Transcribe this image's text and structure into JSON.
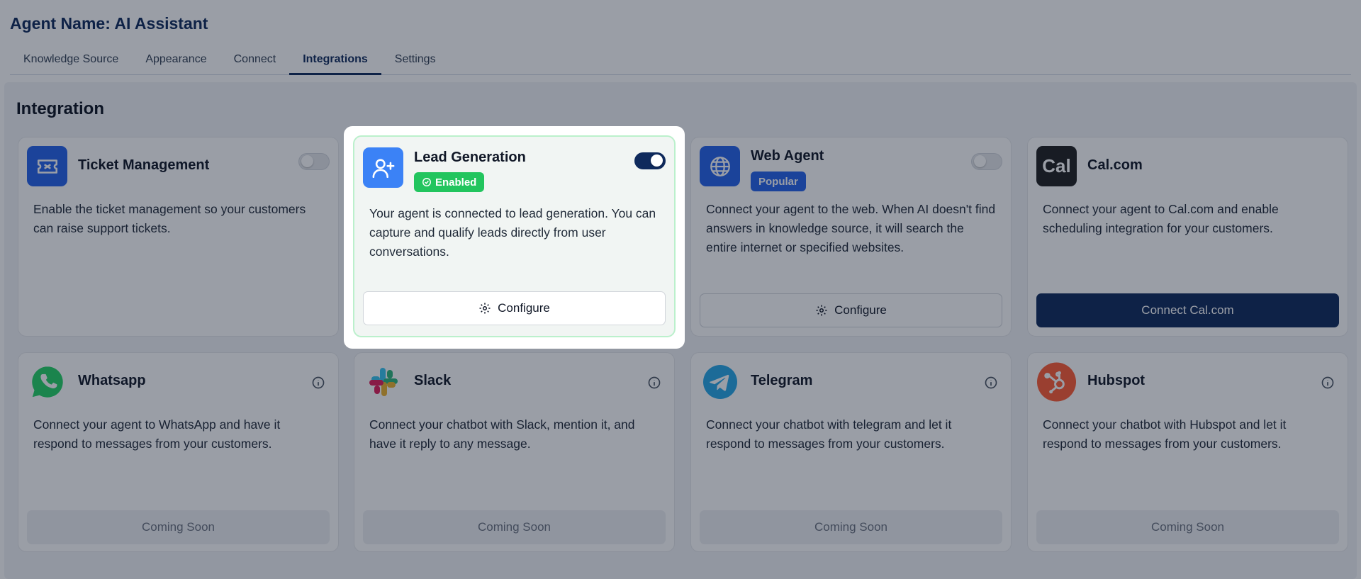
{
  "agent_title": "Agent Name: AI Assistant",
  "tabs": [
    {
      "label": "Knowledge Source"
    },
    {
      "label": "Appearance"
    },
    {
      "label": "Connect"
    },
    {
      "label": "Integrations",
      "active": true
    },
    {
      "label": "Settings"
    }
  ],
  "section_title": "Integration",
  "cards": {
    "ticket": {
      "name": "Ticket Management",
      "icon": "ticket-icon",
      "enabled": false,
      "description": "Enable the ticket management so your customers can raise support tickets."
    },
    "lead": {
      "name": "Lead Generation",
      "icon": "user-plus-icon",
      "badge": "Enabled",
      "enabled": true,
      "description": "Your agent is connected to lead generation. You can capture and qualify leads directly from user conversations.",
      "button": "Configure"
    },
    "web": {
      "name": "Web Agent",
      "icon": "globe-icon",
      "badge": "Popular",
      "enabled": false,
      "description": "Connect your agent to the web. When AI doesn't find answers in knowledge source, it will search the entire internet or specified websites.",
      "button": "Configure"
    },
    "cal": {
      "name": "Cal.com",
      "logo_text": "Cal",
      "description": "Connect your agent to Cal.com and enable scheduling integration for your customers.",
      "button": "Connect Cal.com"
    },
    "whatsapp": {
      "name": "Whatsapp",
      "icon": "whatsapp-icon",
      "description": "Connect your agent to WhatsApp and have it respond to messages from your customers.",
      "button": "Coming Soon"
    },
    "slack": {
      "name": "Slack",
      "icon": "slack-icon",
      "description": "Connect your chatbot with Slack, mention it, and have it reply to any message.",
      "button": "Coming Soon"
    },
    "telegram": {
      "name": "Telegram",
      "icon": "telegram-icon",
      "description": "Connect your chatbot with telegram and let it respond to messages from your customers.",
      "button": "Coming Soon"
    },
    "hubspot": {
      "name": "Hubspot",
      "icon": "hubspot-icon",
      "description": "Connect your chatbot with Hubspot and let it respond to messages from your customers.",
      "button": "Coming Soon"
    }
  },
  "colors": {
    "brand_navy": "#0f2a5c",
    "enabled_green": "#22c55e",
    "popular_blue": "#2563eb",
    "overlay": "rgba(15,23,42,0.42)"
  }
}
